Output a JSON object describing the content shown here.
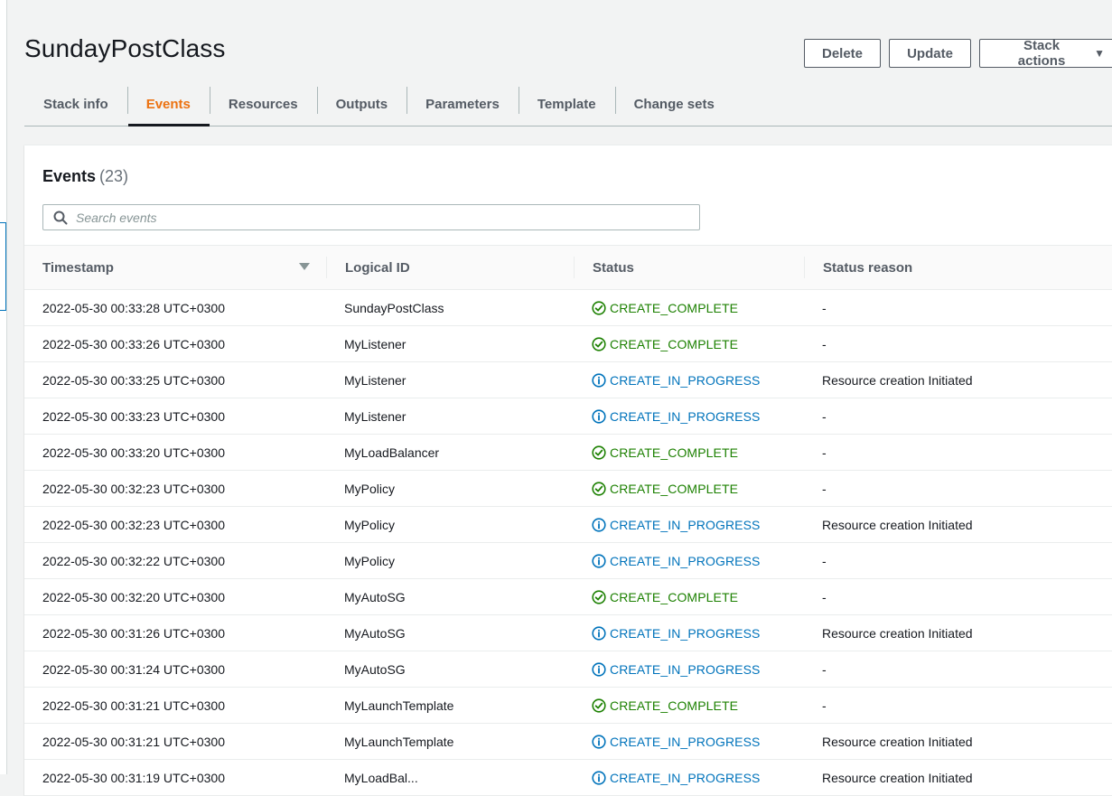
{
  "page": {
    "title": "SundayPostClass"
  },
  "actions": {
    "delete_label": "Delete",
    "update_label": "Update",
    "stack_actions_label": "Stack actions"
  },
  "tabs": [
    {
      "label": "Stack info"
    },
    {
      "label": "Events"
    },
    {
      "label": "Resources"
    },
    {
      "label": "Outputs"
    },
    {
      "label": "Parameters"
    },
    {
      "label": "Template"
    },
    {
      "label": "Change sets"
    }
  ],
  "active_tab": "Events",
  "events": {
    "title": "Events",
    "count": "(23)",
    "search_placeholder": "Search events",
    "columns": {
      "timestamp": "Timestamp",
      "logical_id": "Logical ID",
      "status": "Status",
      "status_reason": "Status reason"
    },
    "rows": [
      {
        "timestamp": "2022-05-30 00:33:28 UTC+0300",
        "logical_id": "SundayPostClass",
        "status": "CREATE_COMPLETE",
        "reason": "-"
      },
      {
        "timestamp": "2022-05-30 00:33:26 UTC+0300",
        "logical_id": "MyListener",
        "status": "CREATE_COMPLETE",
        "reason": "-"
      },
      {
        "timestamp": "2022-05-30 00:33:25 UTC+0300",
        "logical_id": "MyListener",
        "status": "CREATE_IN_PROGRESS",
        "reason": "Resource creation Initiated"
      },
      {
        "timestamp": "2022-05-30 00:33:23 UTC+0300",
        "logical_id": "MyListener",
        "status": "CREATE_IN_PROGRESS",
        "reason": "-"
      },
      {
        "timestamp": "2022-05-30 00:33:20 UTC+0300",
        "logical_id": "MyLoadBalancer",
        "status": "CREATE_COMPLETE",
        "reason": "-"
      },
      {
        "timestamp": "2022-05-30 00:32:23 UTC+0300",
        "logical_id": "MyPolicy",
        "status": "CREATE_COMPLETE",
        "reason": "-"
      },
      {
        "timestamp": "2022-05-30 00:32:23 UTC+0300",
        "logical_id": "MyPolicy",
        "status": "CREATE_IN_PROGRESS",
        "reason": "Resource creation Initiated"
      },
      {
        "timestamp": "2022-05-30 00:32:22 UTC+0300",
        "logical_id": "MyPolicy",
        "status": "CREATE_IN_PROGRESS",
        "reason": "-"
      },
      {
        "timestamp": "2022-05-30 00:32:20 UTC+0300",
        "logical_id": "MyAutoSG",
        "status": "CREATE_COMPLETE",
        "reason": "-"
      },
      {
        "timestamp": "2022-05-30 00:31:26 UTC+0300",
        "logical_id": "MyAutoSG",
        "status": "CREATE_IN_PROGRESS",
        "reason": "Resource creation Initiated"
      },
      {
        "timestamp": "2022-05-30 00:31:24 UTC+0300",
        "logical_id": "MyAutoSG",
        "status": "CREATE_IN_PROGRESS",
        "reason": "-"
      },
      {
        "timestamp": "2022-05-30 00:31:21 UTC+0300",
        "logical_id": "MyLaunchTemplate",
        "status": "CREATE_COMPLETE",
        "reason": "-"
      },
      {
        "timestamp": "2022-05-30 00:31:21 UTC+0300",
        "logical_id": "MyLaunchTemplate",
        "status": "CREATE_IN_PROGRESS",
        "reason": "Resource creation Initiated"
      },
      {
        "timestamp": "2022-05-30 00:31:19 UTC+0300",
        "logical_id": "MyLoadBal...",
        "status": "CREATE_IN_PROGRESS",
        "reason": "Resource creation Initiated"
      }
    ]
  },
  "colors": {
    "complete": "#1d8102",
    "in_progress": "#0073bb",
    "active_tab": "#ec7211"
  },
  "icons": {
    "complete": "check-circle-icon",
    "in_progress": "info-circle-icon",
    "search": "search-icon",
    "sort": "sort-desc-icon",
    "dropdown": "caret-down-icon"
  }
}
